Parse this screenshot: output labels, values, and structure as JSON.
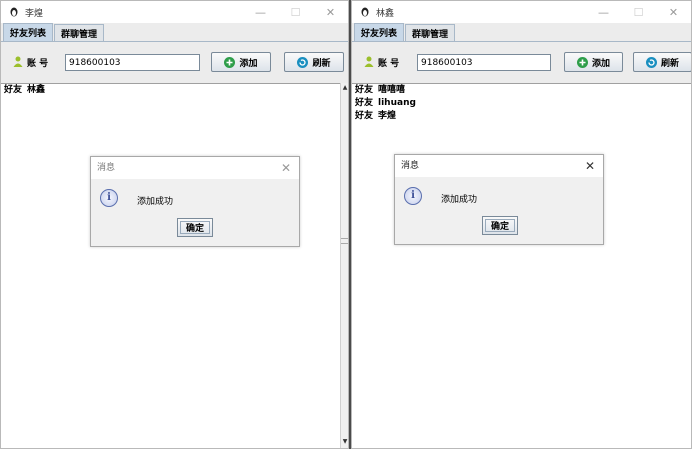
{
  "left_window": {
    "title": "李煌",
    "tabs": [
      "好友列表",
      "群聊管理"
    ],
    "account_label": "账 号",
    "account_value": "918600103",
    "add_label": "添加",
    "refresh_label": "刷新",
    "friends": [
      {
        "prefix": "好友",
        "name": "林鑫"
      }
    ],
    "dialog": {
      "title": "消息",
      "message": "添加成功",
      "ok_label": "确定"
    }
  },
  "right_window": {
    "title": "林鑫",
    "tabs": [
      "好友列表",
      "群聊管理"
    ],
    "account_label": "账 号",
    "account_value": "918600103",
    "add_label": "添加",
    "refresh_label": "刷新",
    "friends": [
      {
        "prefix": "好友",
        "name": "嘻嘻嘻"
      },
      {
        "prefix": "好友",
        "name": "lihuang"
      },
      {
        "prefix": "好友",
        "name": "李煌"
      }
    ],
    "dialog": {
      "title": "消息",
      "message": "添加成功",
      "ok_label": "确定"
    }
  },
  "colors": {
    "add_icon": "#2e9e4a",
    "refresh_icon": "#1a8fc0",
    "user_icon": "#9bbf2c"
  }
}
